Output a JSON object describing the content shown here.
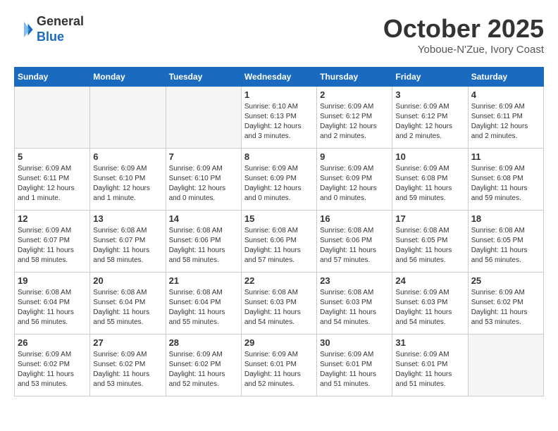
{
  "header": {
    "logo_line1": "General",
    "logo_line2": "Blue",
    "month": "October 2025",
    "location": "Yoboue-N'Zue, Ivory Coast"
  },
  "weekdays": [
    "Sunday",
    "Monday",
    "Tuesday",
    "Wednesday",
    "Thursday",
    "Friday",
    "Saturday"
  ],
  "weeks": [
    [
      {
        "day": "",
        "info": ""
      },
      {
        "day": "",
        "info": ""
      },
      {
        "day": "",
        "info": ""
      },
      {
        "day": "1",
        "info": "Sunrise: 6:10 AM\nSunset: 6:13 PM\nDaylight: 12 hours and 3 minutes."
      },
      {
        "day": "2",
        "info": "Sunrise: 6:09 AM\nSunset: 6:12 PM\nDaylight: 12 hours and 2 minutes."
      },
      {
        "day": "3",
        "info": "Sunrise: 6:09 AM\nSunset: 6:12 PM\nDaylight: 12 hours and 2 minutes."
      },
      {
        "day": "4",
        "info": "Sunrise: 6:09 AM\nSunset: 6:11 PM\nDaylight: 12 hours and 2 minutes."
      }
    ],
    [
      {
        "day": "5",
        "info": "Sunrise: 6:09 AM\nSunset: 6:11 PM\nDaylight: 12 hours and 1 minute."
      },
      {
        "day": "6",
        "info": "Sunrise: 6:09 AM\nSunset: 6:10 PM\nDaylight: 12 hours and 1 minute."
      },
      {
        "day": "7",
        "info": "Sunrise: 6:09 AM\nSunset: 6:10 PM\nDaylight: 12 hours and 0 minutes."
      },
      {
        "day": "8",
        "info": "Sunrise: 6:09 AM\nSunset: 6:09 PM\nDaylight: 12 hours and 0 minutes."
      },
      {
        "day": "9",
        "info": "Sunrise: 6:09 AM\nSunset: 6:09 PM\nDaylight: 12 hours and 0 minutes."
      },
      {
        "day": "10",
        "info": "Sunrise: 6:09 AM\nSunset: 6:08 PM\nDaylight: 11 hours and 59 minutes."
      },
      {
        "day": "11",
        "info": "Sunrise: 6:09 AM\nSunset: 6:08 PM\nDaylight: 11 hours and 59 minutes."
      }
    ],
    [
      {
        "day": "12",
        "info": "Sunrise: 6:09 AM\nSunset: 6:07 PM\nDaylight: 11 hours and 58 minutes."
      },
      {
        "day": "13",
        "info": "Sunrise: 6:08 AM\nSunset: 6:07 PM\nDaylight: 11 hours and 58 minutes."
      },
      {
        "day": "14",
        "info": "Sunrise: 6:08 AM\nSunset: 6:06 PM\nDaylight: 11 hours and 58 minutes."
      },
      {
        "day": "15",
        "info": "Sunrise: 6:08 AM\nSunset: 6:06 PM\nDaylight: 11 hours and 57 minutes."
      },
      {
        "day": "16",
        "info": "Sunrise: 6:08 AM\nSunset: 6:06 PM\nDaylight: 11 hours and 57 minutes."
      },
      {
        "day": "17",
        "info": "Sunrise: 6:08 AM\nSunset: 6:05 PM\nDaylight: 11 hours and 56 minutes."
      },
      {
        "day": "18",
        "info": "Sunrise: 6:08 AM\nSunset: 6:05 PM\nDaylight: 11 hours and 56 minutes."
      }
    ],
    [
      {
        "day": "19",
        "info": "Sunrise: 6:08 AM\nSunset: 6:04 PM\nDaylight: 11 hours and 56 minutes."
      },
      {
        "day": "20",
        "info": "Sunrise: 6:08 AM\nSunset: 6:04 PM\nDaylight: 11 hours and 55 minutes."
      },
      {
        "day": "21",
        "info": "Sunrise: 6:08 AM\nSunset: 6:04 PM\nDaylight: 11 hours and 55 minutes."
      },
      {
        "day": "22",
        "info": "Sunrise: 6:08 AM\nSunset: 6:03 PM\nDaylight: 11 hours and 54 minutes."
      },
      {
        "day": "23",
        "info": "Sunrise: 6:08 AM\nSunset: 6:03 PM\nDaylight: 11 hours and 54 minutes."
      },
      {
        "day": "24",
        "info": "Sunrise: 6:09 AM\nSunset: 6:03 PM\nDaylight: 11 hours and 54 minutes."
      },
      {
        "day": "25",
        "info": "Sunrise: 6:09 AM\nSunset: 6:02 PM\nDaylight: 11 hours and 53 minutes."
      }
    ],
    [
      {
        "day": "26",
        "info": "Sunrise: 6:09 AM\nSunset: 6:02 PM\nDaylight: 11 hours and 53 minutes."
      },
      {
        "day": "27",
        "info": "Sunrise: 6:09 AM\nSunset: 6:02 PM\nDaylight: 11 hours and 53 minutes."
      },
      {
        "day": "28",
        "info": "Sunrise: 6:09 AM\nSunset: 6:02 PM\nDaylight: 11 hours and 52 minutes."
      },
      {
        "day": "29",
        "info": "Sunrise: 6:09 AM\nSunset: 6:01 PM\nDaylight: 11 hours and 52 minutes."
      },
      {
        "day": "30",
        "info": "Sunrise: 6:09 AM\nSunset: 6:01 PM\nDaylight: 11 hours and 51 minutes."
      },
      {
        "day": "31",
        "info": "Sunrise: 6:09 AM\nSunset: 6:01 PM\nDaylight: 11 hours and 51 minutes."
      },
      {
        "day": "",
        "info": ""
      }
    ]
  ]
}
